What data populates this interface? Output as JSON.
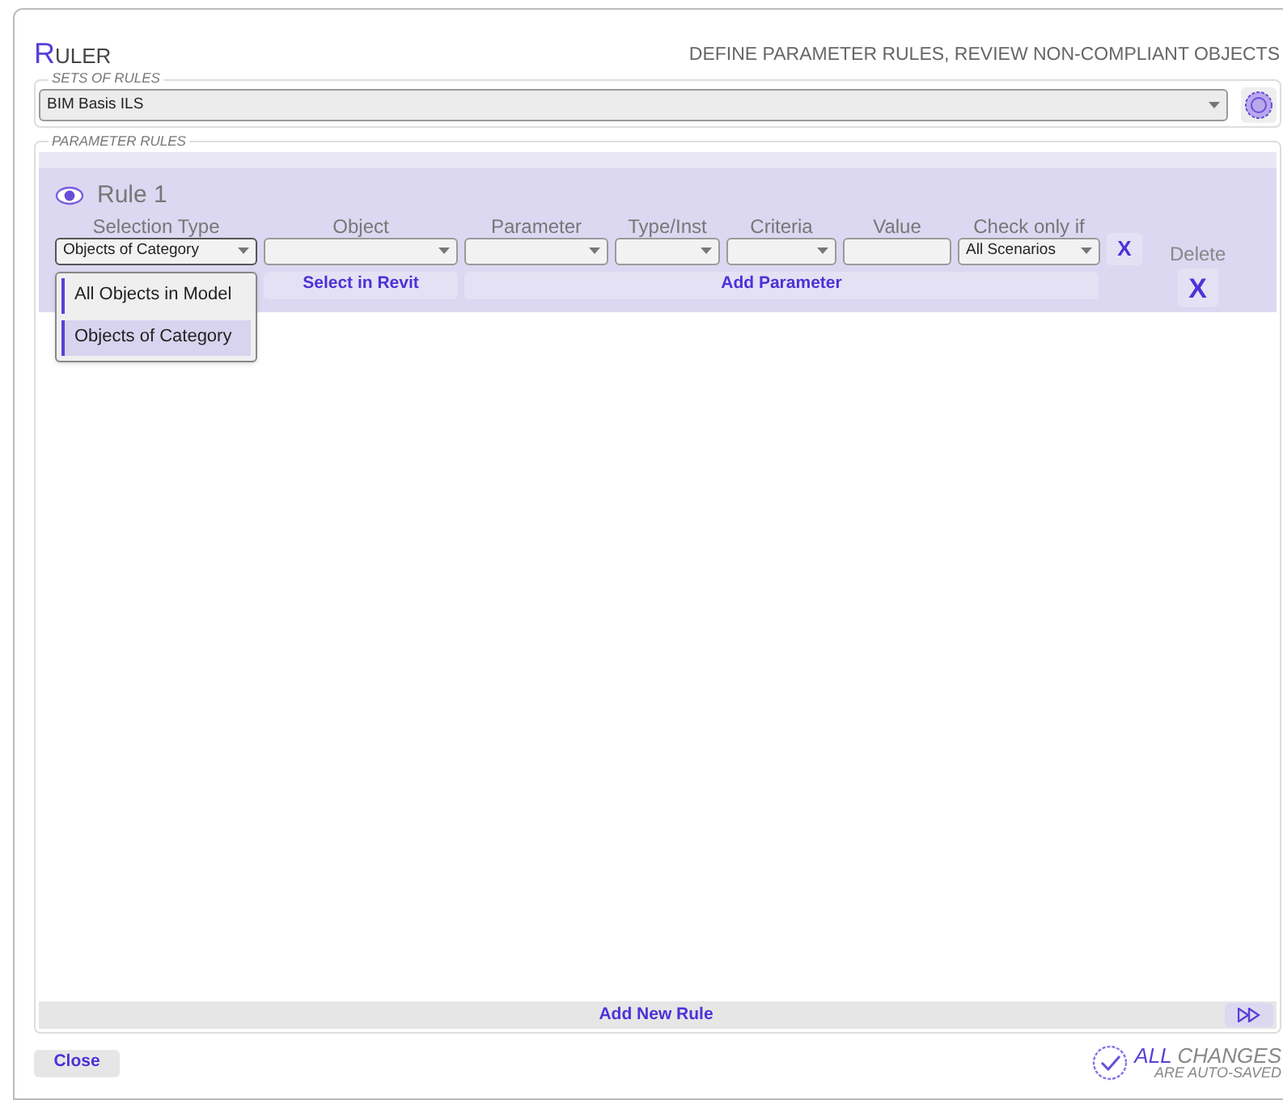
{
  "window": {
    "title": "RULER",
    "subtitle": "DEFINE PARAMETER RULES, REVIEW NON-COMPLIANT OBJECTS"
  },
  "sets_of_rules": {
    "legend": "SETS OF RULES",
    "value": "BIM Basis ILS"
  },
  "parameter_rules": {
    "legend": "PARAMETER RULES",
    "rules": [
      {
        "title": "Rule 1",
        "columns": [
          {
            "heading": "Selection Type",
            "kind": "dropdown",
            "value": "Objects of Category",
            "expanded": true,
            "options": [
              {
                "label": "All Objects in Model",
                "selected": false
              },
              {
                "label": "Objects of Category",
                "selected": true
              }
            ]
          },
          {
            "heading": "Object",
            "kind": "dropdown"
          },
          {
            "heading": "Parameter",
            "kind": "dropdown"
          },
          {
            "heading": "Type/Inst",
            "kind": "dropdown"
          },
          {
            "heading": "Criteria",
            "kind": "dropdown"
          },
          {
            "heading": "Value",
            "kind": "input"
          },
          {
            "heading": "Check only if",
            "kind": "dropdown",
            "value": "All Scenarios"
          }
        ],
        "clear_button": "X",
        "select_button": "Select in Revit",
        "add_parameter_button": "Add Parameter",
        "delete_heading": "Delete",
        "delete_button": "X"
      }
    ],
    "add_button": "Add New Rule"
  },
  "footer": {
    "close_button": "Close",
    "saved_strong": "ALL",
    "saved_rest": "CHANGES",
    "saved_sub": "ARE AUTO-SAVED"
  }
}
